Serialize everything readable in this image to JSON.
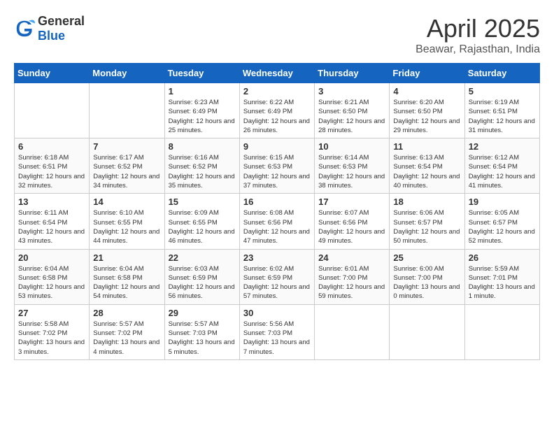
{
  "header": {
    "logo_general": "General",
    "logo_blue": "Blue",
    "month_title": "April 2025",
    "location": "Beawar, Rajasthan, India"
  },
  "weekdays": [
    "Sunday",
    "Monday",
    "Tuesday",
    "Wednesday",
    "Thursday",
    "Friday",
    "Saturday"
  ],
  "weeks": [
    [
      {
        "day": "",
        "info": ""
      },
      {
        "day": "",
        "info": ""
      },
      {
        "day": "1",
        "info": "Sunrise: 6:23 AM\nSunset: 6:49 PM\nDaylight: 12 hours and 25 minutes."
      },
      {
        "day": "2",
        "info": "Sunrise: 6:22 AM\nSunset: 6:49 PM\nDaylight: 12 hours and 26 minutes."
      },
      {
        "day": "3",
        "info": "Sunrise: 6:21 AM\nSunset: 6:50 PM\nDaylight: 12 hours and 28 minutes."
      },
      {
        "day": "4",
        "info": "Sunrise: 6:20 AM\nSunset: 6:50 PM\nDaylight: 12 hours and 29 minutes."
      },
      {
        "day": "5",
        "info": "Sunrise: 6:19 AM\nSunset: 6:51 PM\nDaylight: 12 hours and 31 minutes."
      }
    ],
    [
      {
        "day": "6",
        "info": "Sunrise: 6:18 AM\nSunset: 6:51 PM\nDaylight: 12 hours and 32 minutes."
      },
      {
        "day": "7",
        "info": "Sunrise: 6:17 AM\nSunset: 6:52 PM\nDaylight: 12 hours and 34 minutes."
      },
      {
        "day": "8",
        "info": "Sunrise: 6:16 AM\nSunset: 6:52 PM\nDaylight: 12 hours and 35 minutes."
      },
      {
        "day": "9",
        "info": "Sunrise: 6:15 AM\nSunset: 6:53 PM\nDaylight: 12 hours and 37 minutes."
      },
      {
        "day": "10",
        "info": "Sunrise: 6:14 AM\nSunset: 6:53 PM\nDaylight: 12 hours and 38 minutes."
      },
      {
        "day": "11",
        "info": "Sunrise: 6:13 AM\nSunset: 6:54 PM\nDaylight: 12 hours and 40 minutes."
      },
      {
        "day": "12",
        "info": "Sunrise: 6:12 AM\nSunset: 6:54 PM\nDaylight: 12 hours and 41 minutes."
      }
    ],
    [
      {
        "day": "13",
        "info": "Sunrise: 6:11 AM\nSunset: 6:54 PM\nDaylight: 12 hours and 43 minutes."
      },
      {
        "day": "14",
        "info": "Sunrise: 6:10 AM\nSunset: 6:55 PM\nDaylight: 12 hours and 44 minutes."
      },
      {
        "day": "15",
        "info": "Sunrise: 6:09 AM\nSunset: 6:55 PM\nDaylight: 12 hours and 46 minutes."
      },
      {
        "day": "16",
        "info": "Sunrise: 6:08 AM\nSunset: 6:56 PM\nDaylight: 12 hours and 47 minutes."
      },
      {
        "day": "17",
        "info": "Sunrise: 6:07 AM\nSunset: 6:56 PM\nDaylight: 12 hours and 49 minutes."
      },
      {
        "day": "18",
        "info": "Sunrise: 6:06 AM\nSunset: 6:57 PM\nDaylight: 12 hours and 50 minutes."
      },
      {
        "day": "19",
        "info": "Sunrise: 6:05 AM\nSunset: 6:57 PM\nDaylight: 12 hours and 52 minutes."
      }
    ],
    [
      {
        "day": "20",
        "info": "Sunrise: 6:04 AM\nSunset: 6:58 PM\nDaylight: 12 hours and 53 minutes."
      },
      {
        "day": "21",
        "info": "Sunrise: 6:04 AM\nSunset: 6:58 PM\nDaylight: 12 hours and 54 minutes."
      },
      {
        "day": "22",
        "info": "Sunrise: 6:03 AM\nSunset: 6:59 PM\nDaylight: 12 hours and 56 minutes."
      },
      {
        "day": "23",
        "info": "Sunrise: 6:02 AM\nSunset: 6:59 PM\nDaylight: 12 hours and 57 minutes."
      },
      {
        "day": "24",
        "info": "Sunrise: 6:01 AM\nSunset: 7:00 PM\nDaylight: 12 hours and 59 minutes."
      },
      {
        "day": "25",
        "info": "Sunrise: 6:00 AM\nSunset: 7:00 PM\nDaylight: 13 hours and 0 minutes."
      },
      {
        "day": "26",
        "info": "Sunrise: 5:59 AM\nSunset: 7:01 PM\nDaylight: 13 hours and 1 minute."
      }
    ],
    [
      {
        "day": "27",
        "info": "Sunrise: 5:58 AM\nSunset: 7:02 PM\nDaylight: 13 hours and 3 minutes."
      },
      {
        "day": "28",
        "info": "Sunrise: 5:57 AM\nSunset: 7:02 PM\nDaylight: 13 hours and 4 minutes."
      },
      {
        "day": "29",
        "info": "Sunrise: 5:57 AM\nSunset: 7:03 PM\nDaylight: 13 hours and 5 minutes."
      },
      {
        "day": "30",
        "info": "Sunrise: 5:56 AM\nSunset: 7:03 PM\nDaylight: 13 hours and 7 minutes."
      },
      {
        "day": "",
        "info": ""
      },
      {
        "day": "",
        "info": ""
      },
      {
        "day": "",
        "info": ""
      }
    ]
  ]
}
